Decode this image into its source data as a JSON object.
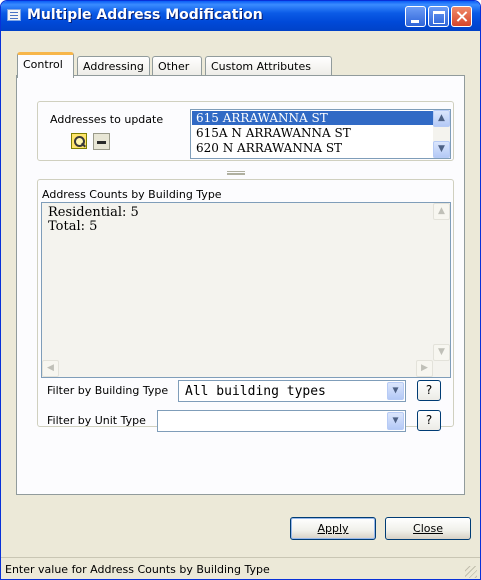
{
  "window": {
    "title": "Multiple Address Modification"
  },
  "tabs": [
    {
      "label": "Control"
    },
    {
      "label": "Addressing"
    },
    {
      "label": "Other"
    },
    {
      "label": "Custom Attributes"
    }
  ],
  "addresses": {
    "label": "Addresses to update",
    "items": [
      "615 ARRAWANNA ST",
      "615A N ARRAWANNA ST",
      "620 N ARRAWANNA ST"
    ],
    "selected_index": 0
  },
  "counts": {
    "label": "Address Counts by Building Type",
    "lines": [
      "Residential: 5",
      "Total: 5"
    ]
  },
  "filters": {
    "building_type": {
      "label": "Filter by Building Type",
      "value": "All building types",
      "help": "?"
    },
    "unit_type": {
      "label": "Filter by Unit Type",
      "value": "",
      "help": "?"
    }
  },
  "buttons": {
    "apply": "Apply",
    "close": "Close"
  },
  "status": {
    "text": "Enter value for Address Counts by Building Type"
  },
  "icons": [
    "app-icon",
    "zoom-icon",
    "minus-icon",
    "minimize-icon",
    "maximize-icon",
    "close-icon",
    "scroll-up-icon",
    "scroll-down-icon",
    "dropdown-arrow-icon",
    "resize-grip-icon"
  ]
}
